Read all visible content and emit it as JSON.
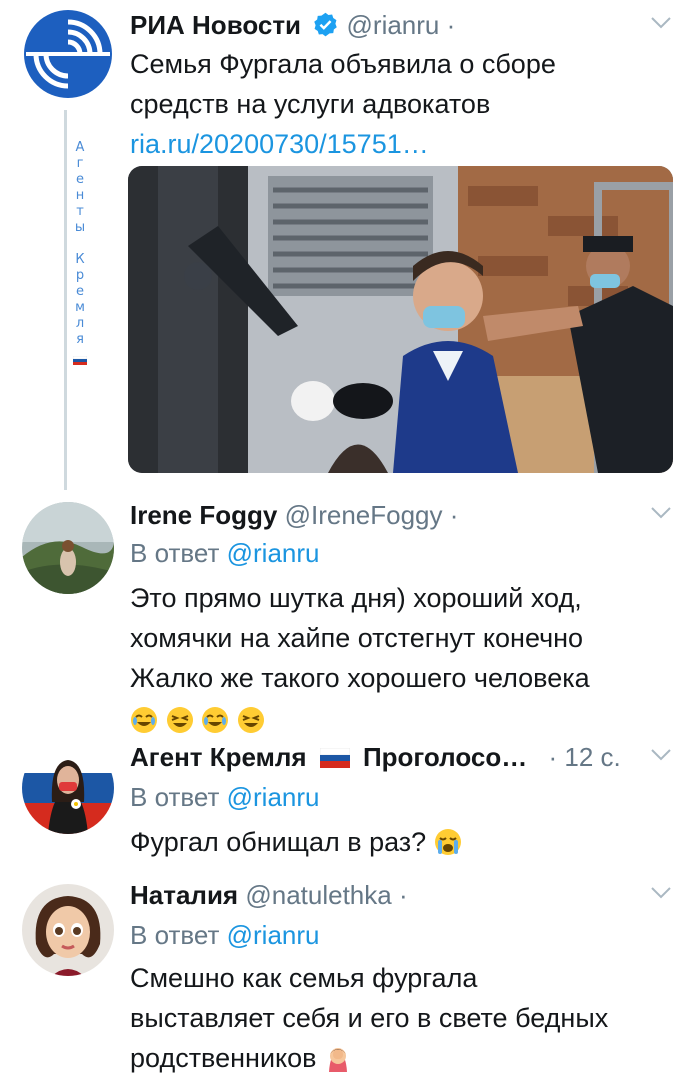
{
  "tweets": [
    {
      "name": "РИА Новости",
      "handle": "@rianru",
      "dot": "·",
      "text_lines": [
        "Семья Фургала объявила о сборе",
        "средств на услуги адвокатов"
      ],
      "link": "ria.ru/20200730/15751…"
    },
    {
      "name": "Irene Foggy",
      "handle": "@IreneFoggy",
      "dot": "·",
      "reply_prefix": "В ответ",
      "reply_mention": "@rianru",
      "text_lines": [
        "Это прямо шутка дня) хороший ход,",
        "хомячки на хайпе отстегнут конечно",
        "Жалко же такого хорошего человека"
      ],
      "emoji": [
        "joy",
        "laughing",
        "joy",
        "laughing"
      ]
    },
    {
      "name": "Агент Кремля",
      "name_suffix": "Проголосо…",
      "handle": "",
      "dot": "·",
      "time": "12 с.",
      "reply_prefix": "В ответ",
      "reply_mention": "@rianru",
      "text_lines": [
        "Фургал обнищал в раз?"
      ],
      "emoji": [
        "crying"
      ]
    },
    {
      "name": "Наталия",
      "handle": "@natulethka",
      "dot": "·",
      "reply_prefix": "В ответ",
      "reply_mention": "@rianru",
      "text_lines": [
        "Смешно как семья фургала",
        "выставляет себя и его в свете бедных",
        "родственников"
      ],
      "emoji": [
        "facepalm"
      ]
    }
  ],
  "watermark": {
    "letters": [
      "А",
      "г",
      "е",
      "н",
      "т",
      "ы",
      " ",
      "К",
      "р",
      "е",
      "м",
      "л",
      "я"
    ]
  },
  "colors": {
    "link": "#1b95e0",
    "secondary": "#657786",
    "text": "#14171a",
    "thread_line": "#cfd9de"
  }
}
